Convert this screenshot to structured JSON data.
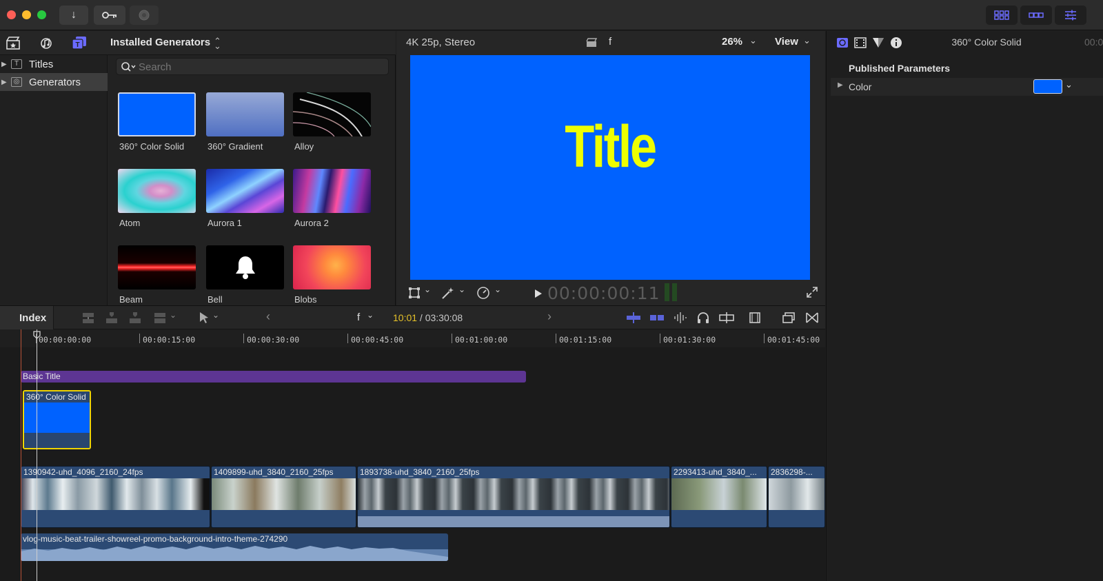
{
  "titlebar": {
    "download_icon": "↓",
    "key_icon": "key-icon",
    "circle_icon": "circle-icon"
  },
  "browser": {
    "header_title": "Installed Generators",
    "sidebar": [
      {
        "label": "Titles",
        "glyph": "T"
      },
      {
        "label": "Generators",
        "glyph": "◎"
      }
    ],
    "search_placeholder": "Search",
    "generators": [
      {
        "label": "360° Color Solid"
      },
      {
        "label": "360° Gradient"
      },
      {
        "label": "Alloy"
      },
      {
        "label": "Atom"
      },
      {
        "label": "Aurora 1"
      },
      {
        "label": "Aurora 2"
      },
      {
        "label": "Beam"
      },
      {
        "label": "Bell"
      },
      {
        "label": "Blobs"
      }
    ]
  },
  "viewer": {
    "format": "4K 25p, Stereo",
    "clapper_label": "f",
    "zoom": "26%",
    "view_label": "View",
    "title_text": "Title",
    "timecode": "00:00:00:11"
  },
  "inspector": {
    "clip_name": "360° Color Solid",
    "duration_partial": "00:0",
    "section_title": "Published Parameters",
    "param_label": "Color",
    "param_color": "#0062ff"
  },
  "timeline": {
    "index_label": "Index",
    "clip_selector": "f",
    "current_time": "10:01",
    "separator": " / ",
    "total_time": "03:30:08",
    "ruler": [
      "00:00:00:00",
      "00:00:15:00",
      "00:00:30:00",
      "00:00:45:00",
      "00:01:00:00",
      "00:01:15:00",
      "00:01:30:00",
      "00:01:45:00"
    ],
    "title_clip": "Basic Title",
    "generator_clip": "360° Color Solid",
    "video_clips": [
      {
        "name": "1390942-uhd_4096_2160_24fps"
      },
      {
        "name": "1409899-uhd_3840_2160_25fps"
      },
      {
        "name": "1893738-uhd_3840_2160_25fps"
      },
      {
        "name": "2293413-uhd_3840_..."
      },
      {
        "name": "2836298-..."
      }
    ],
    "audio_clip": "vlog-music-beat-trailer-showreel-promo-background-intro-theme-274290"
  },
  "colors": {
    "accent_blue": "#0062ff",
    "title_yellow": "#eeff00",
    "playhead_yellow": "#f0d400",
    "title_clip_purple": "#5d3593",
    "time_highlight": "#e6c229"
  }
}
